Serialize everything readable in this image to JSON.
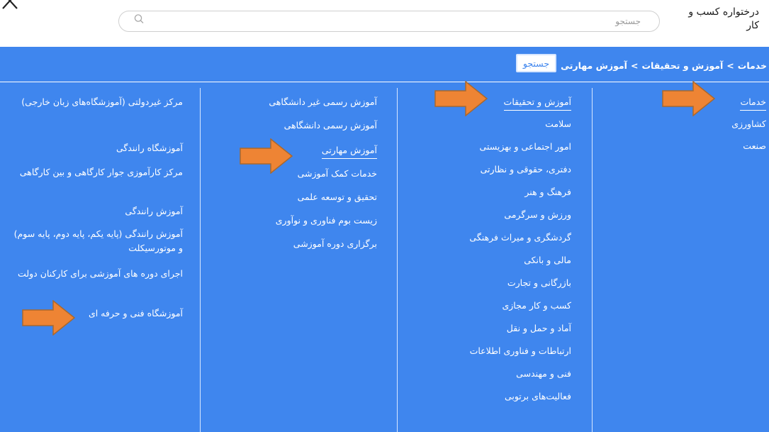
{
  "header": {
    "app_title": "درختواره کسب و کار",
    "search_placeholder": "جستجو",
    "close_icon": "close-icon",
    "search_icon": "search-icon"
  },
  "breadcrumb": {
    "items": [
      "خدمات",
      "آموزش و تحقیقات",
      "آموزش مهارتی"
    ],
    "separator": ">",
    "search_button": "جستجو"
  },
  "columns": {
    "col1": [
      "خدمات",
      "کشاورزی",
      "صنعت"
    ],
    "col2": [
      "آموزش و تحقیقات",
      "سلامت",
      "امور اجتماعی و بهزیستی",
      "دفتری، حقوقی و نظارتی",
      "فرهنگ و هنر",
      "ورزش و سرگرمی",
      "گردشگری و میراث فرهنگی",
      "مالی و بانکی",
      "بازرگانی و تجارت",
      "کسب و کار مجازی",
      "آماد و حمل و نقل",
      "ارتباطات و فناوری اطلاعات",
      "فنی و مهندسی",
      "فعالیت‌های برتوبی"
    ],
    "col3": [
      "آموزش رسمی غیر دانشگاهی",
      "آموزش رسمی دانشگاهی",
      "آموزش مهارتی",
      "خدمات کمک آموزشی",
      "تحقیق و توسعه علمی",
      "زیست بوم فناوری و نوآوری",
      "برگزاری دوره آموزشی"
    ],
    "col4": [
      "مرکز غیردولتی (آموزشگاه‌های زبان خارجی)",
      "آموزشگاه رانندگی",
      "مرکز کارآموزی جوار کارگاهی و بین کارگاهی",
      "آموزش رانندگی",
      "آموزش رانندگی (پایه یکم، پایه دوم، پایه سوم) و موتورسیکلت",
      "اجرای دوره های آموزشی برای کارکنان دولت",
      "آموزشگاه فنی و حرفه ای"
    ]
  },
  "colors": {
    "panel": "#3f86ee",
    "arrow": "#ee8434",
    "arrow_stroke": "#a9682e"
  }
}
